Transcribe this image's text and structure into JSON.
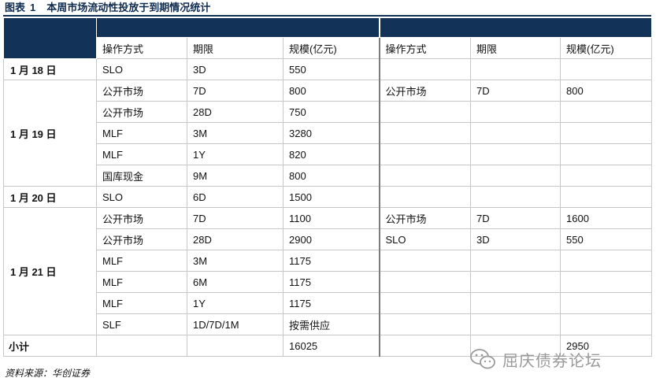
{
  "caption": {
    "label": "图表",
    "number": "1",
    "text": "本周市场流动性投放于到期情况统计"
  },
  "headers": {
    "left": [
      "操作方式",
      "期限",
      "规模(亿元)"
    ],
    "right": [
      "操作方式",
      "期限",
      "规模(亿元)"
    ]
  },
  "rows": {
    "r1": {
      "date": "1 月 18 日",
      "l": [
        "SLO",
        "3D",
        "550"
      ],
      "r": [
        "",
        "",
        ""
      ]
    },
    "r2": {
      "date": "1 月 19 日",
      "l": [
        "公开市场",
        "7D",
        "800"
      ],
      "r": [
        "公开市场",
        "7D",
        "800"
      ]
    },
    "r3": {
      "l": [
        "公开市场",
        "28D",
        "750"
      ],
      "r": [
        "",
        "",
        ""
      ]
    },
    "r4": {
      "l": [
        "MLF",
        "3M",
        "3280"
      ],
      "r": [
        "",
        "",
        ""
      ]
    },
    "r5": {
      "l": [
        "MLF",
        "1Y",
        "820"
      ],
      "r": [
        "",
        "",
        ""
      ]
    },
    "r6": {
      "l": [
        "国库现金",
        "9M",
        "800"
      ],
      "r": [
        "",
        "",
        ""
      ]
    },
    "r7": {
      "date": "1 月 20 日",
      "l": [
        "SLO",
        "6D",
        "1500"
      ],
      "r": [
        "",
        "",
        ""
      ]
    },
    "r8": {
      "date": "1 月 21 日",
      "l": [
        "公开市场",
        "7D",
        "1100"
      ],
      "r": [
        "公开市场",
        "7D",
        "1600"
      ]
    },
    "r9": {
      "l": [
        "公开市场",
        "28D",
        "2900"
      ],
      "r": [
        "SLO",
        "3D",
        "550"
      ]
    },
    "r10": {
      "l": [
        "MLF",
        "3M",
        "1175"
      ],
      "r": [
        "",
        "",
        ""
      ]
    },
    "r11": {
      "l": [
        "MLF",
        "6M",
        "1175"
      ],
      "r": [
        "",
        "",
        ""
      ]
    },
    "r12": {
      "l": [
        "MLF",
        "1Y",
        "1175"
      ],
      "r": [
        "",
        "",
        ""
      ]
    },
    "r13": {
      "l": [
        "SLF",
        "1D/7D/1M",
        "按需供应"
      ],
      "r": [
        "",
        "",
        ""
      ]
    }
  },
  "total": {
    "label": "小计",
    "left_value": "16025",
    "right_value": "2950"
  },
  "source": "资料来源：华创证券",
  "watermark": {
    "text": "屈庆债券论坛",
    "icon": "wechat-icon"
  },
  "colors": {
    "header_band": "#123258",
    "grid_line": "#c7c7c7",
    "watermark": "#9a9a9a"
  }
}
